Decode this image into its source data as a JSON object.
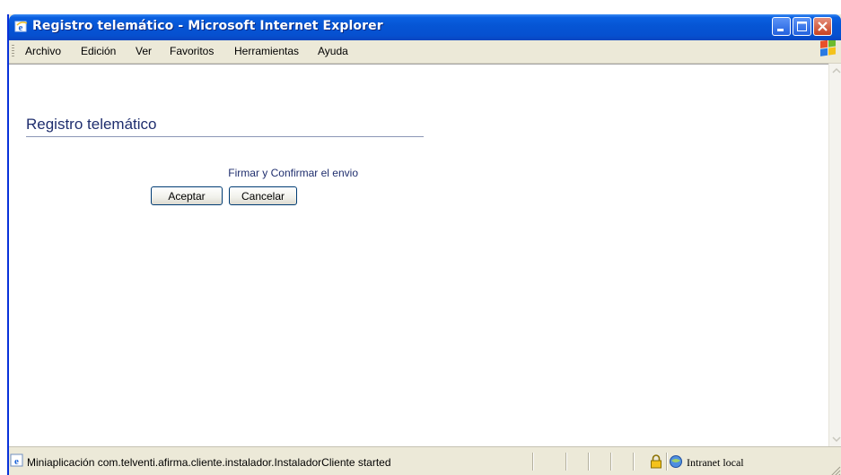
{
  "window": {
    "title": "Registro telemático - Microsoft Internet Explorer"
  },
  "menu": {
    "items": [
      "Archivo",
      "Edición",
      "Ver",
      "Favoritos",
      "Herramientas",
      "Ayuda"
    ]
  },
  "page": {
    "title": "Registro telemático",
    "prompt": "Firmar y Confirmar el envio",
    "accept_label": "Aceptar",
    "cancel_label": "Cancelar"
  },
  "status": {
    "text": "Miniaplicación com.telventi.afirma.cliente.instalador.InstaladorCliente started",
    "zone": "Intranet local"
  },
  "colors": {
    "titlebar": "#0655d4",
    "page_text": "#1f2e6e",
    "chrome": "#ece9d8"
  }
}
